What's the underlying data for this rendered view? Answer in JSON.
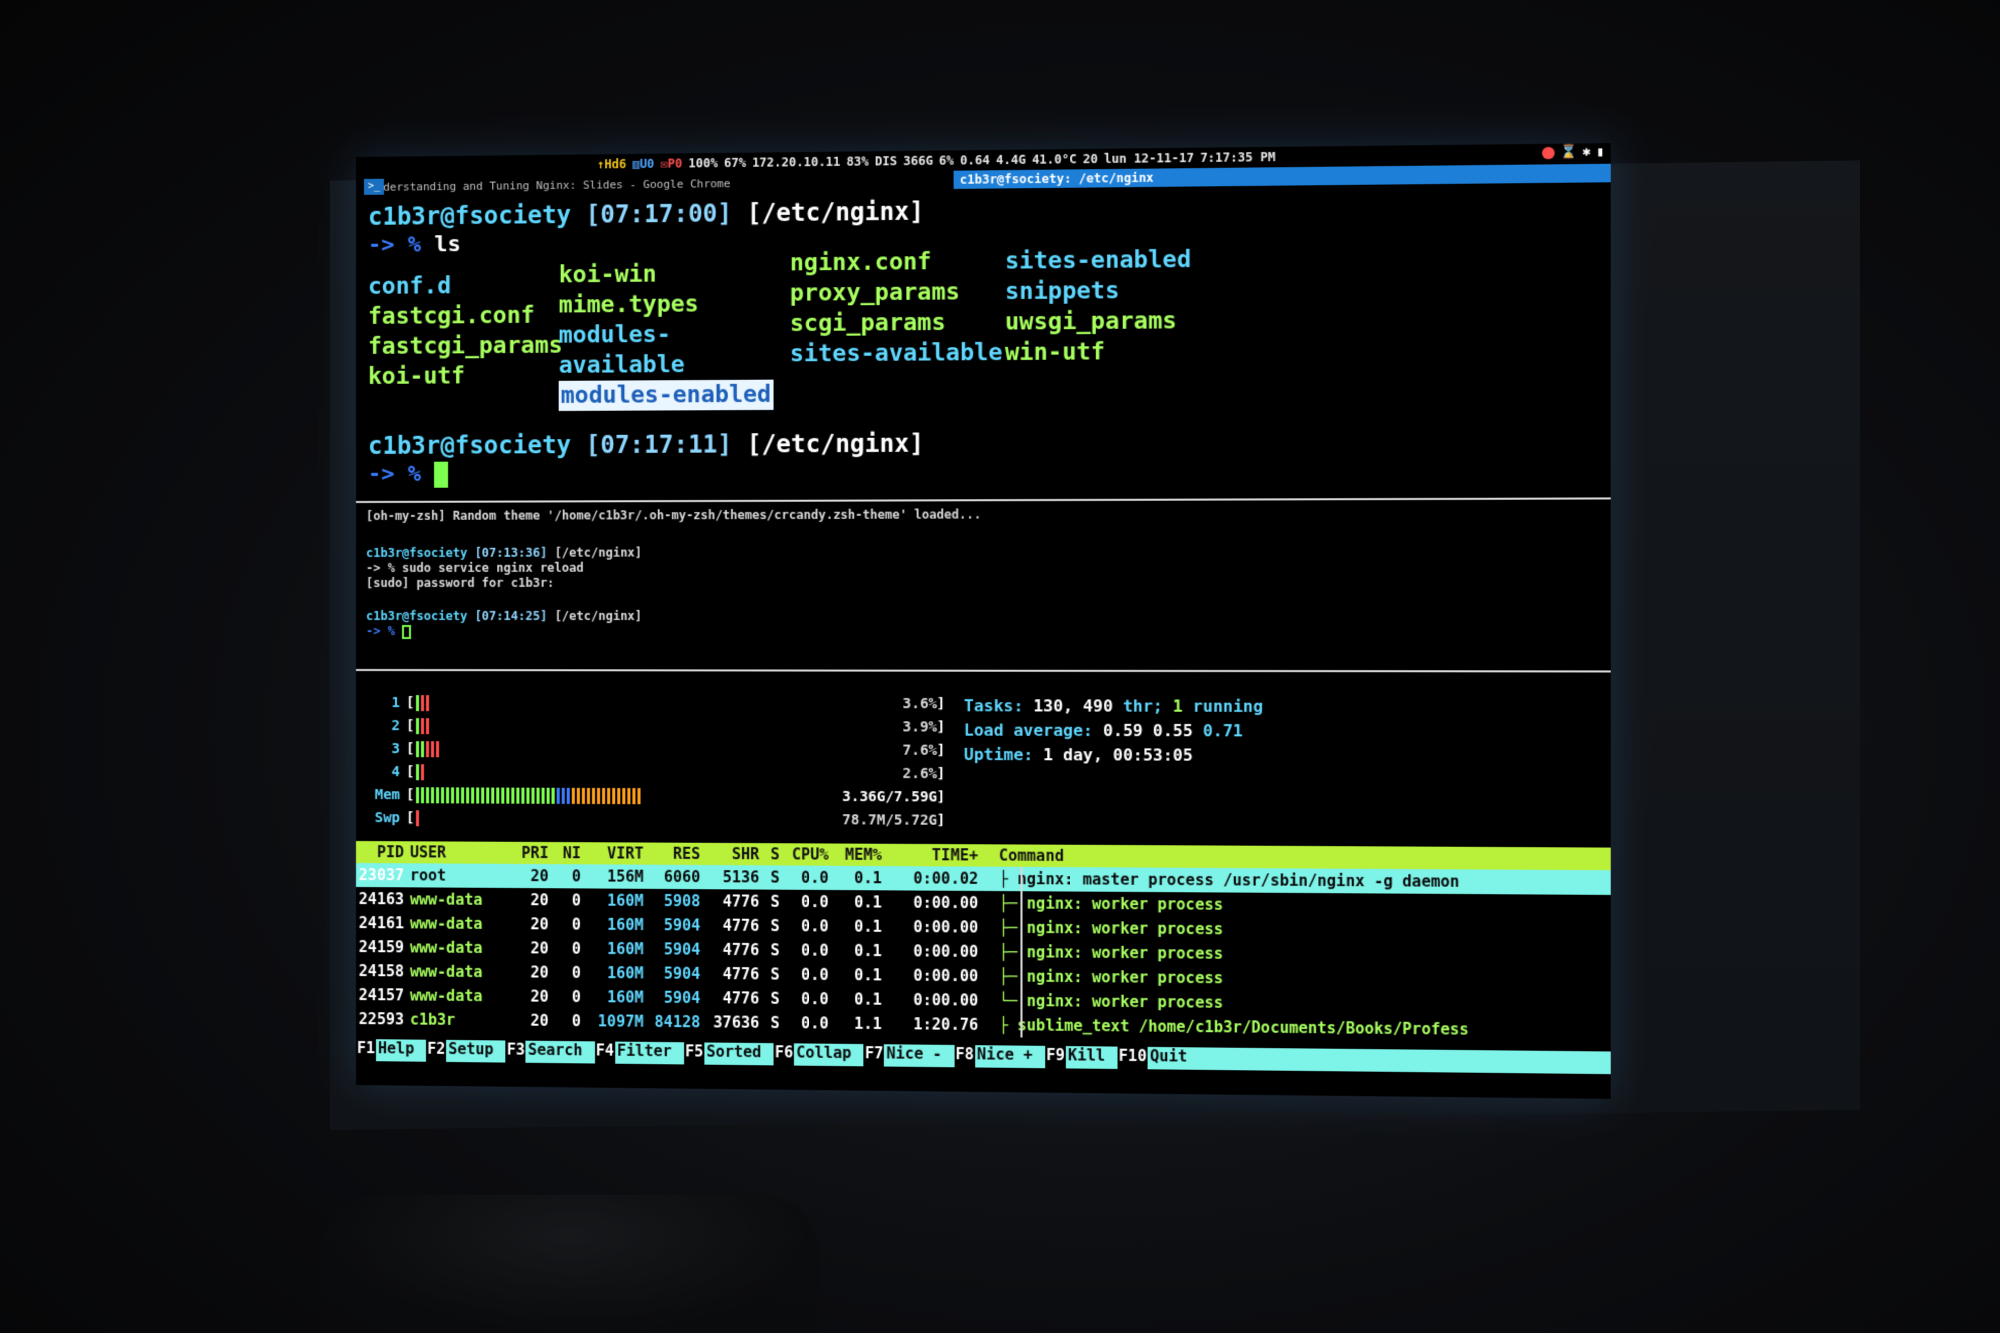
{
  "statusbar": {
    "stats": [
      {
        "text": "↑Hd6",
        "tone": "y"
      },
      {
        "text": "▥U0",
        "tone": "b"
      },
      {
        "text": "✉P0",
        "tone": "r"
      },
      {
        "text": "100%",
        "tone": "w"
      },
      {
        "text": "67%",
        "tone": "w"
      },
      {
        "text": "172.20.10.11",
        "tone": "w"
      },
      {
        "text": "83%",
        "tone": "w"
      },
      {
        "text": "DIS",
        "tone": "w"
      },
      {
        "text": "366G",
        "tone": "w"
      },
      {
        "text": "6%",
        "tone": "w"
      },
      {
        "text": "0.64",
        "tone": "w"
      },
      {
        "text": "4.4G",
        "tone": "w"
      },
      {
        "text": "41.0°C",
        "tone": "w"
      },
      {
        "text": "20",
        "tone": "w"
      },
      {
        "text": "lun 12-11-17",
        "tone": "w"
      },
      {
        "text": "7:17:35 PM",
        "tone": "w"
      }
    ],
    "terminal_icon": ">_"
  },
  "titlebar": {
    "left_title": "Understanding and Tuning Nginx: Slides - Google Chrome",
    "active_title": "c1b3r@fsociety: /etc/nginx"
  },
  "pane1": {
    "prompt1": {
      "user": "c1b3r@fsociety",
      "time": "[07:17:00]",
      "path": "[/etc/nginx]"
    },
    "cmd1": {
      "arrow": "-> %",
      "text": "ls"
    },
    "ls_columns": [
      [
        {
          "name": "conf.d",
          "kind": "blue"
        },
        {
          "name": "fastcgi.conf",
          "kind": "green"
        },
        {
          "name": "fastcgi_params",
          "kind": "green"
        },
        {
          "name": "koi-utf",
          "kind": "green"
        }
      ],
      [
        {
          "name": "koi-win",
          "kind": "green"
        },
        {
          "name": "mime.types",
          "kind": "green"
        },
        {
          "name": "modules-available",
          "kind": "blue"
        },
        {
          "name": "modules-enabled",
          "kind": "sel"
        }
      ],
      [
        {
          "name": "nginx.conf",
          "kind": "green"
        },
        {
          "name": "proxy_params",
          "kind": "green"
        },
        {
          "name": "scgi_params",
          "kind": "green"
        },
        {
          "name": "sites-available",
          "kind": "blue"
        }
      ],
      [
        {
          "name": "sites-enabled",
          "kind": "blue"
        },
        {
          "name": "snippets",
          "kind": "blue"
        },
        {
          "name": "uwsgi_params",
          "kind": "green"
        },
        {
          "name": "win-utf",
          "kind": "green"
        }
      ]
    ],
    "prompt2": {
      "user": "c1b3r@fsociety",
      "time": "[07:17:11]",
      "path": "[/etc/nginx]"
    },
    "cmd2": {
      "arrow": "-> %"
    }
  },
  "pane2": {
    "theme_line": "[oh-my-zsh] Random theme '/home/c1b3r/.oh-my-zsh/themes/crcandy.zsh-theme' loaded...",
    "p1_user": "c1b3r@fsociety",
    "p1_time": "[07:13:36]",
    "p1_path": "[/etc/nginx]",
    "cmd": "-> % sudo service nginx reload",
    "sudo": "[sudo] password for c1b3r:",
    "p2_user": "c1b3r@fsociety",
    "p2_time": "[07:14:25]",
    "p2_path": "[/etc/nginx]",
    "arrow": "-> %"
  },
  "htop": {
    "meters": [
      {
        "label": "1",
        "value": "3.6%",
        "green": 1,
        "red": 2,
        "blue": 0,
        "orange": 0
      },
      {
        "label": "2",
        "value": "3.9%",
        "green": 1,
        "red": 2,
        "blue": 0,
        "orange": 0
      },
      {
        "label": "3",
        "value": "7.6%",
        "green": 2,
        "red": 3,
        "blue": 0,
        "orange": 0
      },
      {
        "label": "4",
        "value": "2.6%",
        "green": 1,
        "red": 1,
        "blue": 0,
        "orange": 0
      },
      {
        "label": "Mem",
        "value": "3.36G/7.59G",
        "green": 28,
        "red": 0,
        "blue": 3,
        "orange": 14
      },
      {
        "label": "Swp",
        "value": "78.7M/5.72G",
        "green": 0,
        "red": 1,
        "blue": 0,
        "orange": 0
      }
    ],
    "tasks_label": "Tasks:",
    "tasks_count": "130,",
    "thr_count": "490",
    "thr_label": "thr;",
    "running_count": "1",
    "running_label": "running",
    "load_label": "Load average:",
    "load1": "0.59",
    "load5": "0.55",
    "load15": "0.71",
    "uptime_label": "Uptime:",
    "uptime_value": "1 day, 00:53:05",
    "headers": [
      "PID",
      "USER",
      "PRI",
      "NI",
      "VIRT",
      "RES",
      "SHR",
      "S",
      "CPU%",
      "MEM%",
      "TIME+",
      "Command"
    ],
    "rows": [
      {
        "pid": "23037",
        "user": "root",
        "pri": "20",
        "ni": "0",
        "virt": "156M",
        "res": "6060",
        "shr": "5136",
        "s": "S",
        "cpu": "0.0",
        "mem": "0.1",
        "time": "0:00.02",
        "cmd": "├ nginx: master process /usr/sbin/nginx -g daemon",
        "selected": true
      },
      {
        "pid": "24163",
        "user": "www-data",
        "pri": "20",
        "ni": "0",
        "virt": "160M",
        "res": "5908",
        "shr": "4776",
        "s": "S",
        "cpu": "0.0",
        "mem": "0.1",
        "time": "0:00.00",
        "cmd": "├─ nginx: worker process",
        "selected": false
      },
      {
        "pid": "24161",
        "user": "www-data",
        "pri": "20",
        "ni": "0",
        "virt": "160M",
        "res": "5904",
        "shr": "4776",
        "s": "S",
        "cpu": "0.0",
        "mem": "0.1",
        "time": "0:00.00",
        "cmd": "├─ nginx: worker process",
        "selected": false
      },
      {
        "pid": "24159",
        "user": "www-data",
        "pri": "20",
        "ni": "0",
        "virt": "160M",
        "res": "5904",
        "shr": "4776",
        "s": "S",
        "cpu": "0.0",
        "mem": "0.1",
        "time": "0:00.00",
        "cmd": "├─ nginx: worker process",
        "selected": false
      },
      {
        "pid": "24158",
        "user": "www-data",
        "pri": "20",
        "ni": "0",
        "virt": "160M",
        "res": "5904",
        "shr": "4776",
        "s": "S",
        "cpu": "0.0",
        "mem": "0.1",
        "time": "0:00.00",
        "cmd": "├─ nginx: worker process",
        "selected": false
      },
      {
        "pid": "24157",
        "user": "www-data",
        "pri": "20",
        "ni": "0",
        "virt": "160M",
        "res": "5904",
        "shr": "4776",
        "s": "S",
        "cpu": "0.0",
        "mem": "0.1",
        "time": "0:00.00",
        "cmd": "└─ nginx: worker process",
        "selected": false
      },
      {
        "pid": "22593",
        "user": "c1b3r",
        "pri": "20",
        "ni": "0",
        "virt": "1097M",
        "res": "84128",
        "shr": "37636",
        "s": "S",
        "cpu": "0.0",
        "mem": "1.1",
        "time": "1:20.76",
        "cmd": "├ sublime_text /home/c1b3r/Documents/Books/Profess",
        "selected": false
      }
    ],
    "fkeys": [
      {
        "key": "F1",
        "name": "Help"
      },
      {
        "key": "F2",
        "name": "Setup"
      },
      {
        "key": "F3",
        "name": "Search"
      },
      {
        "key": "F4",
        "name": "Filter"
      },
      {
        "key": "F5",
        "name": "Sorted"
      },
      {
        "key": "F6",
        "name": "Collap"
      },
      {
        "key": "F7",
        "name": "Nice -"
      },
      {
        "key": "F8",
        "name": "Nice +"
      },
      {
        "key": "F9",
        "name": "Kill"
      },
      {
        "key": "F10",
        "name": "Quit"
      }
    ]
  }
}
